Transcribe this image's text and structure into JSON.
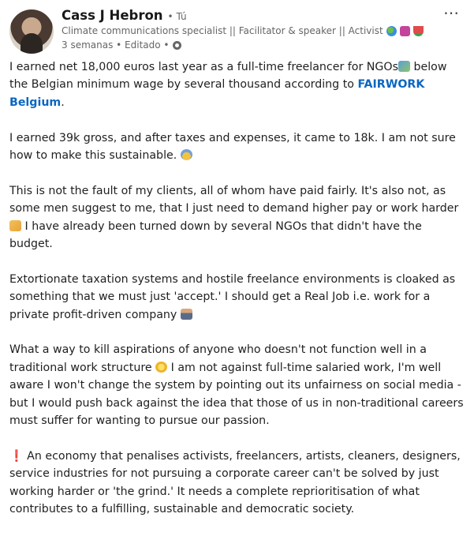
{
  "author": {
    "name": "Cass J Hebron",
    "degree": "• Tú",
    "headline": "Climate communications specialist || Facilitator & speaker || Activist",
    "meta": "3 semanas • Editado •"
  },
  "post": {
    "p1_a": "I earned net 18,000 euros last year as a full-time freelancer for NGOs",
    "p1_b": " below the Belgian minimum wage by several thousand according to ",
    "p1_link": "FAIRWORK Belgium",
    "p1_c": ".",
    "p2": "I earned 39k gross, and after taxes and expenses, it came to 18k. I am not sure how to make this sustainable. ",
    "p3_a": "This is not the fault of my clients, all of whom have paid fairly. It's also not, as some men suggest to me, that I just need to demand higher pay or work harder ",
    "p3_b": " I have already been turned down by several NGOs that didn't have the budget.",
    "p4": "Extortionate taxation systems and hostile freelance environments is cloaked as something that we must just 'accept.' I should get a Real Job i.e. work for a private profit-driven company ",
    "p5_a": "What a way to kill aspirations of anyone who doesn't not function well in a traditional work structure ",
    "p5_b": " I am not against full-time salaried work, I'm well aware I won't change the system by pointing out its unfairness on social media - but I would push back against the idea that those of us in non-traditional careers must suffer for wanting to pursue our passion.",
    "p6_mark": "❗",
    "p6": " An economy that penalises activists, freelancers, artists, cleaners, designers, service industries for not pursuing a corporate career can't be solved by just working harder or 'the grind.' It needs a complete reprioritisation of what contributes to a fulfilling, sustainable and democratic society."
  },
  "icons": {
    "more": "⋯",
    "accent": "#0a66c2"
  }
}
